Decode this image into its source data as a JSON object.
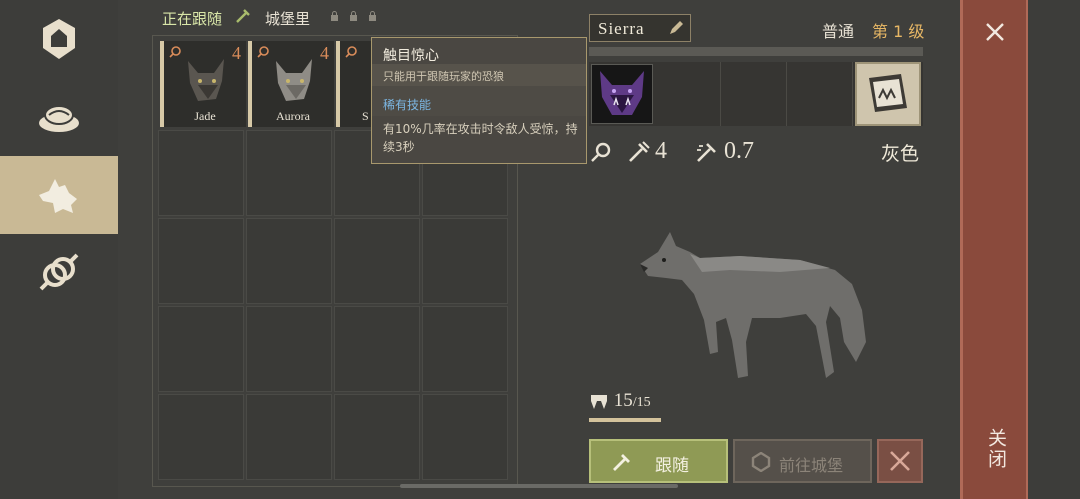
{
  "header": {
    "tab_following": "正在跟随",
    "tab_castle": "城堡里"
  },
  "nav": {
    "items": [
      "home-icon",
      "food-icon",
      "wolf-icon",
      "gender-icon"
    ],
    "active": "wolf-icon"
  },
  "wolves": [
    {
      "name": "Jade",
      "count": "4"
    },
    {
      "name": "Aurora",
      "count": "4"
    },
    {
      "name": "S",
      "count": ""
    }
  ],
  "tooltip": {
    "title": "触目惊心",
    "subtitle": "只能用于跟随玩家的恐狼",
    "tag": "稀有技能",
    "description": "有10%几率在攻击时令敌人受惊，持续3秒"
  },
  "pet": {
    "name": "Sierra",
    "rarity": "普通",
    "level": "第 1 级",
    "attack": "4",
    "speed": "0.7",
    "color": "灰色",
    "hunger_current": "15",
    "hunger_max": "/15",
    "hunger_fraction": 1.0
  },
  "buttons": {
    "follow": "跟随",
    "go_castle": "前往城堡",
    "close": "关闭"
  },
  "colors": {
    "accent_follow": "#8f9a55",
    "close_panel": "#8a4a3c",
    "level_gold": "#e7b765",
    "count_orange": "#d98c5a"
  }
}
